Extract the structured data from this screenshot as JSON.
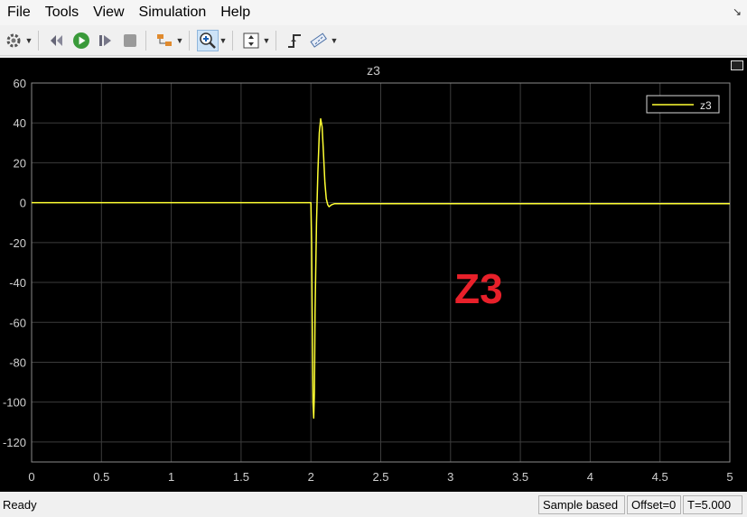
{
  "menu": [
    "File",
    "Tools",
    "View",
    "Simulation",
    "Help"
  ],
  "plot": {
    "title": "z3",
    "legend_label": "z3",
    "overlay_label": "Z3",
    "line_color": "#ffff33",
    "overlay_color": "#e8202a"
  },
  "status": {
    "ready": "Ready",
    "sample": "Sample based",
    "offset": "Offset=0",
    "time": "T=5.000"
  },
  "chart_data": {
    "type": "line",
    "title": "z3",
    "xlabel": "",
    "ylabel": "",
    "xlim": [
      0,
      5
    ],
    "ylim": [
      -130,
      60
    ],
    "xticks": [
      0,
      0.5,
      1,
      1.5,
      2,
      2.5,
      3,
      3.5,
      4,
      4.5,
      5
    ],
    "yticks": [
      60,
      40,
      20,
      0,
      -20,
      -40,
      -60,
      -80,
      -100,
      -120
    ],
    "grid": true,
    "legend": "top-right",
    "series": [
      {
        "name": "z3",
        "x": [
          0,
          2.0,
          2.005,
          2.01,
          2.015,
          2.02,
          2.025,
          2.03,
          2.04,
          2.05,
          2.06,
          2.07,
          2.08,
          2.09,
          2.1,
          2.11,
          2.12,
          2.13,
          2.14,
          2.15,
          2.17,
          2.2,
          2.25,
          2.3,
          5
        ],
        "y": [
          0,
          0,
          -20,
          -60,
          -100,
          -108,
          -95,
          -55,
          -10,
          15,
          35,
          42,
          38,
          25,
          10,
          2,
          -1,
          -2,
          -1.5,
          -1,
          -0.5,
          -0.5,
          -0.5,
          -0.5,
          -0.5
        ]
      }
    ]
  }
}
